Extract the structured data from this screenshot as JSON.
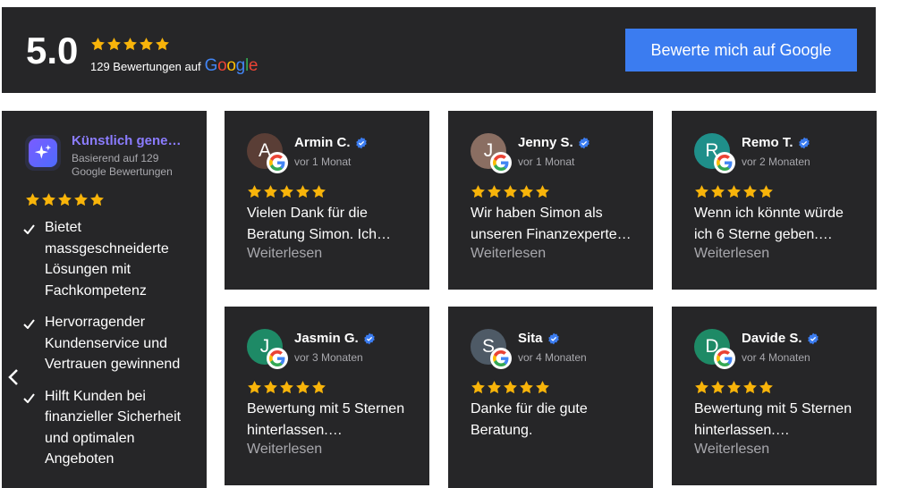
{
  "header": {
    "rating": "5.0",
    "review_count_text": "129 Bewertungen auf",
    "google": [
      "G",
      "o",
      "o",
      "g",
      "l",
      "e"
    ],
    "cta_label": "Bewerte mich auf Google"
  },
  "ai_summary": {
    "title": "Künstlich generiert",
    "subtitle": "Basierend auf 129 Google Bewertungen",
    "points": [
      "Bietet massgeschneiderte Lösungen mit Fachkompetenz",
      "Hervorragender Kundenservice und Vertrauen gewinnend",
      "Hilft Kunden bei finanzieller Sicherheit und optimalen Angeboten"
    ]
  },
  "read_more_label": "Weiterlesen",
  "reviews": [
    {
      "name": "Armin C.",
      "initial": "A",
      "time": "vor 1 Monat",
      "text": "Vielen Dank für die Beratung Simon. Ich…",
      "avatar_color": "#5a3e36"
    },
    {
      "name": "Jenny S.",
      "initial": "J",
      "time": "vor 1 Monat",
      "text": "Wir haben Simon als unseren Finanzexperte…",
      "avatar_color": "#8a6e62"
    },
    {
      "name": "Remo T.",
      "initial": "R",
      "time": "vor 2 Monaten",
      "text": "Wenn ich könnte würde ich 6 Sterne geben.…",
      "avatar_color": "#1f8f8a"
    },
    {
      "name": "Jasmin G.",
      "initial": "J",
      "time": "vor 3 Monaten",
      "text": "Bewertung mit 5 Sternen hinterlassen.…",
      "avatar_color": "#1e8a66"
    },
    {
      "name": "Sita",
      "initial": "S",
      "time": "vor 4 Monaten",
      "text": "Danke für die gute Beratung.",
      "avatar_color": "#4e5a66"
    },
    {
      "name": "Davide S.",
      "initial": "D",
      "time": "vor 4 Monaten",
      "text": "Bewertung mit 5 Sternen hinterlassen.…",
      "avatar_color": "#1e8a66"
    }
  ],
  "colors": {
    "card_bg": "#262628",
    "star": "#f8b40a",
    "accent": "#3b7cf0",
    "ai_title": "#8b7cff",
    "verified": "#3b7cf0"
  },
  "icons": [
    "star-icon",
    "check-icon",
    "verified-icon",
    "google-g-icon",
    "ai-sparkle-icon",
    "chevron-left-icon",
    "chevron-right-icon"
  ]
}
